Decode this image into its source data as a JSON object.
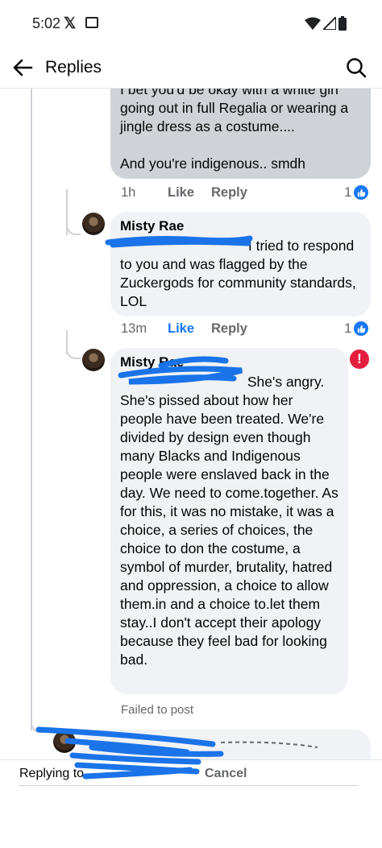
{
  "status_bar": {
    "time": "5:02",
    "x_logo": "𝕏"
  },
  "header": {
    "title": "Replies"
  },
  "comments": [
    {
      "text": "I bet you'd be okay with a white girl going out in full Regalia or wearing a jingle dress as a costume....\n\nAnd you're indigenous.. smdh",
      "time": "1h",
      "like": "Like",
      "reply": "Reply",
      "reactions": "1"
    },
    {
      "author": "Misty Rae",
      "text_after_mention": " I tried to respond to you and was flagged by the Zuckergods for community standards, LOL",
      "time": "13m",
      "like": "Like",
      "reply": "Reply",
      "reactions": "1"
    },
    {
      "author": "Misty Rae",
      "text_after_mention": " She's angry. She's pissed about how her people have been treated. We're divided by design even though many Blacks and Indigenous people were enslaved back in the day. We need to come.together. As for this, it was no mistake, it was a choice, a series of choices, the choice to don the costume, a symbol of murder, brutality, hatred and oppression, a choice to allow them.in and a choice to.let them stay..I don't accept their apology because they feel bad for looking bad.",
      "status": "Failed to post",
      "error_glyph": "!"
    }
  ],
  "reply_bar": {
    "prefix": "Replying to",
    "cancel": "Cancel"
  },
  "colors": {
    "accent": "#1877f2",
    "error": "#e41e3f",
    "scribble": "#1a73e8"
  }
}
